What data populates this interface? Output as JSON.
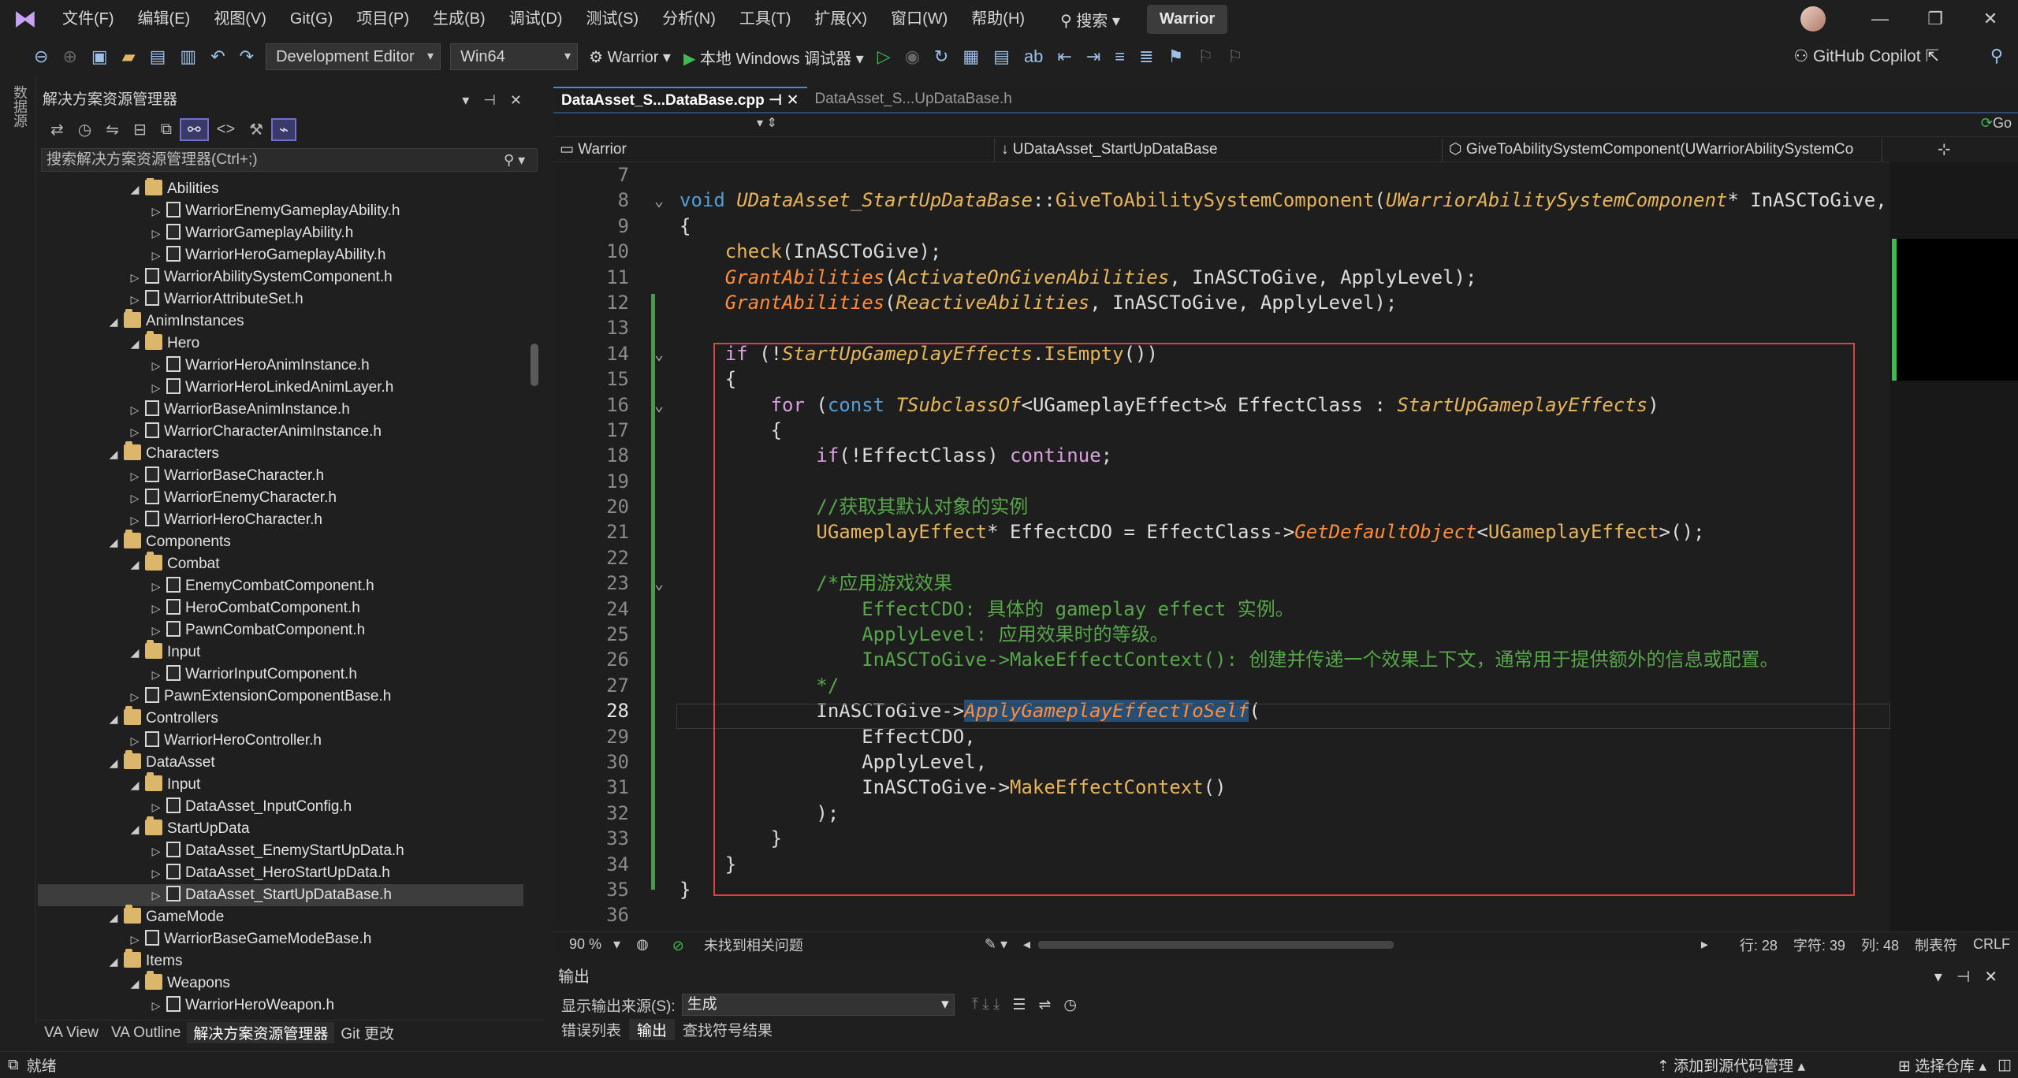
{
  "menubar": {
    "items": [
      "文件(F)",
      "编辑(E)",
      "视图(V)",
      "Git(G)",
      "项目(P)",
      "生成(B)",
      "调试(D)",
      "测试(S)",
      "分析(N)",
      "工具(T)",
      "扩展(X)",
      "窗口(W)",
      "帮助(H)"
    ],
    "search_label": "搜索",
    "project_title": "Warrior"
  },
  "toolbar": {
    "config": "Development Editor",
    "platform": "Win64",
    "startup_project": "Warrior",
    "debugger": "本地 Windows 调试器",
    "copilot": "GitHub Copilot"
  },
  "left_strip": {
    "label": "数据源"
  },
  "solution_explorer": {
    "title": "解决方案资源管理器",
    "search_placeholder": "搜索解决方案资源管理器(Ctrl+;)",
    "tree": [
      {
        "label": "Abilities",
        "type": "folder",
        "depth": 2,
        "arrow": "◢"
      },
      {
        "label": "WarriorEnemyGameplayAbility.h",
        "type": "file",
        "depth": 3,
        "arrow": "▷"
      },
      {
        "label": "WarriorGameplayAbility.h",
        "type": "file",
        "depth": 3,
        "arrow": "▷"
      },
      {
        "label": "WarriorHeroGameplayAbility.h",
        "type": "file",
        "depth": 3,
        "arrow": "▷"
      },
      {
        "label": "WarriorAbilitySystemComponent.h",
        "type": "file",
        "depth": 2,
        "arrow": "▷"
      },
      {
        "label": "WarriorAttributeSet.h",
        "type": "file",
        "depth": 2,
        "arrow": "▷"
      },
      {
        "label": "AnimInstances",
        "type": "folder",
        "depth": 1,
        "arrow": "◢"
      },
      {
        "label": "Hero",
        "type": "folder",
        "depth": 2,
        "arrow": "◢"
      },
      {
        "label": "WarriorHeroAnimInstance.h",
        "type": "file",
        "depth": 3,
        "arrow": "▷"
      },
      {
        "label": "WarriorHeroLinkedAnimLayer.h",
        "type": "file",
        "depth": 3,
        "arrow": "▷"
      },
      {
        "label": "WarriorBaseAnimInstance.h",
        "type": "file",
        "depth": 2,
        "arrow": "▷"
      },
      {
        "label": "WarriorCharacterAnimInstance.h",
        "type": "file",
        "depth": 2,
        "arrow": "▷"
      },
      {
        "label": "Characters",
        "type": "folder",
        "depth": 1,
        "arrow": "◢"
      },
      {
        "label": "WarriorBaseCharacter.h",
        "type": "file",
        "depth": 2,
        "arrow": "▷"
      },
      {
        "label": "WarriorEnemyCharacter.h",
        "type": "file",
        "depth": 2,
        "arrow": "▷"
      },
      {
        "label": "WarriorHeroCharacter.h",
        "type": "file",
        "depth": 2,
        "arrow": "▷"
      },
      {
        "label": "Components",
        "type": "folder",
        "depth": 1,
        "arrow": "◢"
      },
      {
        "label": "Combat",
        "type": "folder",
        "depth": 2,
        "arrow": "◢"
      },
      {
        "label": "EnemyCombatComponent.h",
        "type": "file",
        "depth": 3,
        "arrow": "▷"
      },
      {
        "label": "HeroCombatComponent.h",
        "type": "file",
        "depth": 3,
        "arrow": "▷"
      },
      {
        "label": "PawnCombatComponent.h",
        "type": "file",
        "depth": 3,
        "arrow": "▷"
      },
      {
        "label": "Input",
        "type": "folder",
        "depth": 2,
        "arrow": "◢"
      },
      {
        "label": "WarriorInputComponent.h",
        "type": "file",
        "depth": 3,
        "arrow": "▷"
      },
      {
        "label": "PawnExtensionComponentBase.h",
        "type": "file",
        "depth": 2,
        "arrow": "▷"
      },
      {
        "label": "Controllers",
        "type": "folder",
        "depth": 1,
        "arrow": "◢"
      },
      {
        "label": "WarriorHeroController.h",
        "type": "file",
        "depth": 2,
        "arrow": "▷"
      },
      {
        "label": "DataAsset",
        "type": "folder",
        "depth": 1,
        "arrow": "◢"
      },
      {
        "label": "Input",
        "type": "folder",
        "depth": 2,
        "arrow": "◢"
      },
      {
        "label": "DataAsset_InputConfig.h",
        "type": "file",
        "depth": 3,
        "arrow": "▷"
      },
      {
        "label": "StartUpData",
        "type": "folder",
        "depth": 2,
        "arrow": "◢"
      },
      {
        "label": "DataAsset_EnemyStartUpData.h",
        "type": "file",
        "depth": 3,
        "arrow": "▷"
      },
      {
        "label": "DataAsset_HeroStartUpData.h",
        "type": "file",
        "depth": 3,
        "arrow": "▷"
      },
      {
        "label": "DataAsset_StartUpDataBase.h",
        "type": "file",
        "depth": 3,
        "arrow": "▷",
        "selected": true
      },
      {
        "label": "GameMode",
        "type": "folder",
        "depth": 1,
        "arrow": "◢"
      },
      {
        "label": "WarriorBaseGameModeBase.h",
        "type": "file",
        "depth": 2,
        "arrow": "▷"
      },
      {
        "label": "Items",
        "type": "folder",
        "depth": 1,
        "arrow": "◢"
      },
      {
        "label": "Weapons",
        "type": "folder",
        "depth": 2,
        "arrow": "◢"
      },
      {
        "label": "WarriorHeroWeapon.h",
        "type": "file",
        "depth": 3,
        "arrow": "▷"
      }
    ],
    "bottom_tabs": [
      "VA View",
      "VA Outline",
      "解决方案资源管理器",
      "Git 更改"
    ]
  },
  "editor": {
    "tabs": [
      {
        "label": "DataAsset_S...DataBase.cpp",
        "active": true
      },
      {
        "label": "DataAsset_S...UpDataBase.h",
        "active": false
      }
    ],
    "nav_project": "Warrior",
    "nav_class": "UDataAsset_StartUpDataBase",
    "nav_member": "GiveToAbilitySystemComponent(UWarriorAbilitySystemCo",
    "nav_go": "Go",
    "current_line": 28,
    "lines": [
      {
        "n": 7,
        "t": []
      },
      {
        "n": 8,
        "t": [
          [
            "kw",
            "void "
          ],
          [
            "ty",
            "UDataAsset_StartUpDataBase"
          ],
          [
            "pl",
            "::"
          ],
          [
            "fn",
            "GiveToAbilitySystemComponent"
          ],
          [
            "pl",
            "("
          ],
          [
            "ty",
            "UWarriorAbilitySystemComponent"
          ],
          [
            "pl",
            "* InASCToGive, in"
          ]
        ]
      },
      {
        "n": 9,
        "t": [
          [
            "pl",
            "{"
          ]
        ]
      },
      {
        "n": 10,
        "t": [
          [
            "pl",
            "    "
          ],
          [
            "fn",
            "check"
          ],
          [
            "pl",
            "(InASCToGive);"
          ]
        ]
      },
      {
        "n": 11,
        "t": [
          [
            "pl",
            "    "
          ],
          [
            "fni",
            "GrantAbilities"
          ],
          [
            "pl",
            "("
          ],
          [
            "ty",
            "ActivateOnGivenAbilities"
          ],
          [
            "pl",
            ", InASCToGive, ApplyLevel);"
          ]
        ]
      },
      {
        "n": 12,
        "t": [
          [
            "pl",
            "    "
          ],
          [
            "fni",
            "GrantAbilities"
          ],
          [
            "pl",
            "("
          ],
          [
            "ty",
            "ReactiveAbilities"
          ],
          [
            "pl",
            ", InASCToGive, ApplyLevel);"
          ]
        ]
      },
      {
        "n": 13,
        "t": []
      },
      {
        "n": 14,
        "t": [
          [
            "pl",
            "    "
          ],
          [
            "ctl2",
            "if"
          ],
          [
            "pl",
            " (!"
          ],
          [
            "ty",
            "StartUpGameplayEffects"
          ],
          [
            "pl",
            "."
          ],
          [
            "fn",
            "IsEmpty"
          ],
          [
            "pl",
            "())"
          ]
        ]
      },
      {
        "n": 15,
        "t": [
          [
            "pl",
            "    {"
          ]
        ]
      },
      {
        "n": 16,
        "t": [
          [
            "pl",
            "        "
          ],
          [
            "ctl2",
            "for"
          ],
          [
            "pl",
            " ("
          ],
          [
            "kw",
            "const "
          ],
          [
            "ty",
            "TSubclassOf"
          ],
          [
            "pl",
            "<UGameplayEffect>& EffectClass : "
          ],
          [
            "ty",
            "StartUpGameplayEffects"
          ],
          [
            "pl",
            ")"
          ]
        ]
      },
      {
        "n": 17,
        "t": [
          [
            "pl",
            "        {"
          ]
        ]
      },
      {
        "n": 18,
        "t": [
          [
            "pl",
            "            "
          ],
          [
            "ctl2",
            "if"
          ],
          [
            "pl",
            "(!EffectClass) "
          ],
          [
            "ctl2",
            "continue"
          ],
          [
            "pl",
            ";"
          ]
        ]
      },
      {
        "n": 19,
        "t": []
      },
      {
        "n": 20,
        "t": [
          [
            "pl",
            "            "
          ],
          [
            "cm",
            "//获取其默认对象的实例"
          ]
        ]
      },
      {
        "n": 21,
        "t": [
          [
            "pl",
            "            "
          ],
          [
            "fn",
            "UGameplayEffect"
          ],
          [
            "pl",
            "* EffectCDO = EffectClass->"
          ],
          [
            "fni",
            "GetDefaultObject"
          ],
          [
            "pl",
            "<"
          ],
          [
            "fn",
            "UGameplayEffect"
          ],
          [
            "pl",
            ">();"
          ]
        ]
      },
      {
        "n": 22,
        "t": []
      },
      {
        "n": 23,
        "t": [
          [
            "pl",
            "            "
          ],
          [
            "cm",
            "/*应用游戏效果"
          ]
        ]
      },
      {
        "n": 24,
        "t": [
          [
            "cm",
            "                EffectCDO: 具体的 gameplay effect 实例。"
          ]
        ]
      },
      {
        "n": 25,
        "t": [
          [
            "cm",
            "                ApplyLevel: 应用效果时的等级。"
          ]
        ]
      },
      {
        "n": 26,
        "t": [
          [
            "cm",
            "                InASCToGive->MakeEffectContext(): 创建并传递一个效果上下文，通常用于提供额外的信息或配置。"
          ]
        ]
      },
      {
        "n": 27,
        "t": [
          [
            "pl",
            "            "
          ],
          [
            "cm",
            "*/"
          ]
        ]
      },
      {
        "n": 28,
        "t": [
          [
            "pl",
            "            InASCToGive->"
          ],
          [
            "fni",
            "ApplyGameplayEffectToSelf"
          ],
          [
            "pl",
            "("
          ]
        ]
      },
      {
        "n": 29,
        "t": [
          [
            "pl",
            "                EffectCDO,"
          ]
        ]
      },
      {
        "n": 30,
        "t": [
          [
            "pl",
            "                ApplyLevel,"
          ]
        ]
      },
      {
        "n": 31,
        "t": [
          [
            "pl",
            "                InASCToGive->"
          ],
          [
            "fn",
            "MakeEffectContext"
          ],
          [
            "pl",
            "()"
          ]
        ]
      },
      {
        "n": 32,
        "t": [
          [
            "pl",
            "            );"
          ]
        ]
      },
      {
        "n": 33,
        "t": [
          [
            "pl",
            "        }"
          ]
        ]
      },
      {
        "n": 34,
        "t": [
          [
            "pl",
            "    }"
          ]
        ]
      },
      {
        "n": 35,
        "t": [
          [
            "pl",
            "}"
          ]
        ]
      },
      {
        "n": 36,
        "t": []
      }
    ],
    "status": {
      "zoom": "90 %",
      "issues": "未找到相关问题",
      "row": "行: 28",
      "char": "字符: 39",
      "col": "列: 48",
      "tab": "制表符",
      "eol": "CRLF"
    }
  },
  "output": {
    "title": "输出",
    "source_label": "显示输出来源(S):",
    "source_value": "生成",
    "tabs": [
      "错误列表",
      "输出",
      "查找符号结果"
    ]
  },
  "statusbar": {
    "ready": "就绪",
    "add_source": "添加到源代码管理",
    "select_repo": "选择仓库"
  }
}
